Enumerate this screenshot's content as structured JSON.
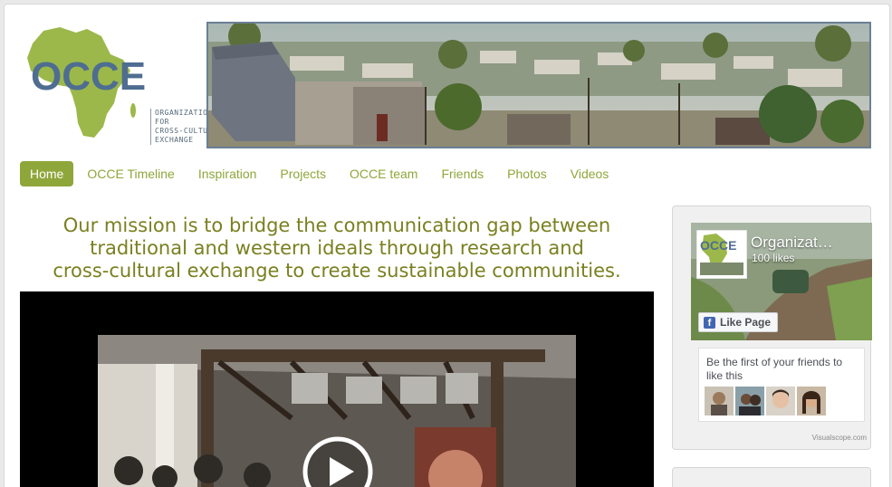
{
  "logo": {
    "acronym": "OCCE",
    "subtitle_lines": [
      "ORGANIZATION",
      "FOR",
      "CROSS-CULTURAL",
      "EXCHANGE"
    ],
    "africa_color": "#9cb84a",
    "text_color": "#4f6d91"
  },
  "nav": {
    "items": [
      {
        "label": "Home",
        "active": true
      },
      {
        "label": "OCCE Timeline",
        "active": false
      },
      {
        "label": "Inspiration",
        "active": false
      },
      {
        "label": "Projects",
        "active": false
      },
      {
        "label": "OCCE team",
        "active": false
      },
      {
        "label": "Friends",
        "active": false
      },
      {
        "label": "Photos",
        "active": false
      },
      {
        "label": "Videos",
        "active": false
      }
    ],
    "accent_color": "#8fa63a"
  },
  "mission": {
    "line1": "Our mission is to bridge the communication gap between",
    "line2": "traditional and western ideals through research and",
    "line3": "cross-cultural exchange to create sustainable communities."
  },
  "video": {
    "play_icon": "play-icon"
  },
  "facebook": {
    "page_name": "Organization for Cross-Cultural Exchange",
    "page_name_display": "Organizat…",
    "likes": "100 likes",
    "like_button": "Like Page",
    "friends_text": "Be the first of your friends to like this",
    "credit": "Visualscope.com",
    "brand_color": "#4267b2"
  }
}
